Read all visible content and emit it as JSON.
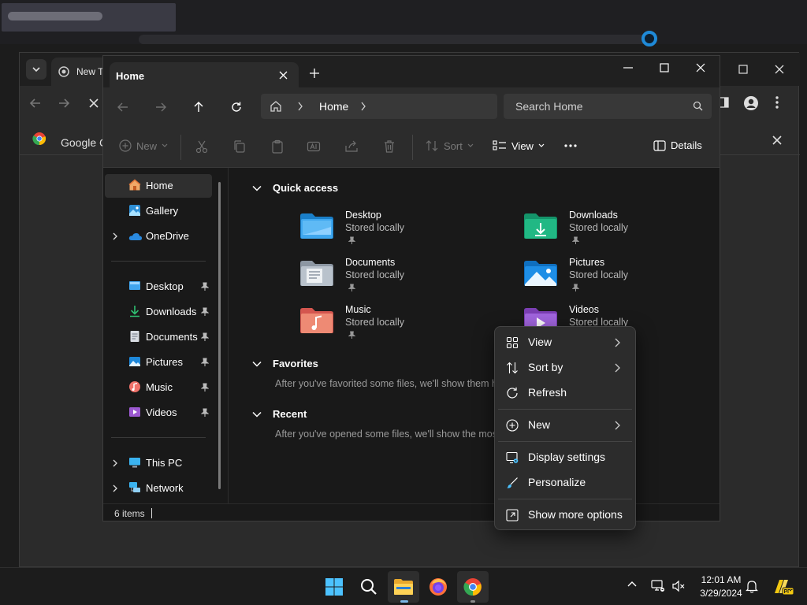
{
  "chrome": {
    "tab_label": "New T",
    "bookmark_label": "Google C"
  },
  "explorer": {
    "tab_title": "Home",
    "address_text": "Home",
    "search_placeholder": "Search Home",
    "toolbar": {
      "new_label": "New",
      "sort_label": "Sort",
      "view_label": "View",
      "details_label": "Details"
    },
    "nav": {
      "items": [
        {
          "label": "Home",
          "icon": "home-icon"
        },
        {
          "label": "Gallery",
          "icon": "gallery-icon"
        },
        {
          "label": "OneDrive",
          "icon": "onedrive-icon"
        },
        {
          "label": "Desktop",
          "icon": "desktop-folder-icon"
        },
        {
          "label": "Downloads",
          "icon": "downloads-folder-icon"
        },
        {
          "label": "Documents",
          "icon": "documents-folder-icon"
        },
        {
          "label": "Pictures",
          "icon": "pictures-folder-icon"
        },
        {
          "label": "Music",
          "icon": "music-folder-icon"
        },
        {
          "label": "Videos",
          "icon": "videos-folder-icon"
        },
        {
          "label": "This PC",
          "icon": "this-pc-icon"
        },
        {
          "label": "Network",
          "icon": "network-icon"
        }
      ]
    },
    "sections": {
      "quick_access": "Quick access",
      "favorites": "Favorites",
      "favorites_hint": "After you've favorited some files, we'll show them here.",
      "recent": "Recent",
      "recent_hint": "After you've opened some files, we'll show the most recent ones here."
    },
    "quick_access": [
      {
        "name": "Desktop",
        "status": "Stored locally"
      },
      {
        "name": "Downloads",
        "status": "Stored locally"
      },
      {
        "name": "Documents",
        "status": "Stored locally"
      },
      {
        "name": "Pictures",
        "status": "Stored locally"
      },
      {
        "name": "Music",
        "status": "Stored locally"
      },
      {
        "name": "Videos",
        "status": "Stored locally"
      }
    ],
    "status_bar": "6 items"
  },
  "context_menu": {
    "items": [
      {
        "label": "View",
        "has_submenu": true
      },
      {
        "label": "Sort by",
        "has_submenu": true
      },
      {
        "label": "Refresh",
        "has_submenu": false
      },
      {
        "label": "New",
        "has_submenu": true
      },
      {
        "label": "Display settings",
        "has_submenu": false
      },
      {
        "label": "Personalize",
        "has_submenu": false
      },
      {
        "label": "Show more options",
        "has_submenu": false
      }
    ]
  },
  "taskbar": {
    "time": "12:01 AM",
    "date": "3/29/2024"
  },
  "colors": {
    "accent": "#4cc2ff",
    "window_bg": "#191919",
    "toolbar_bg": "#2c2c2c"
  }
}
